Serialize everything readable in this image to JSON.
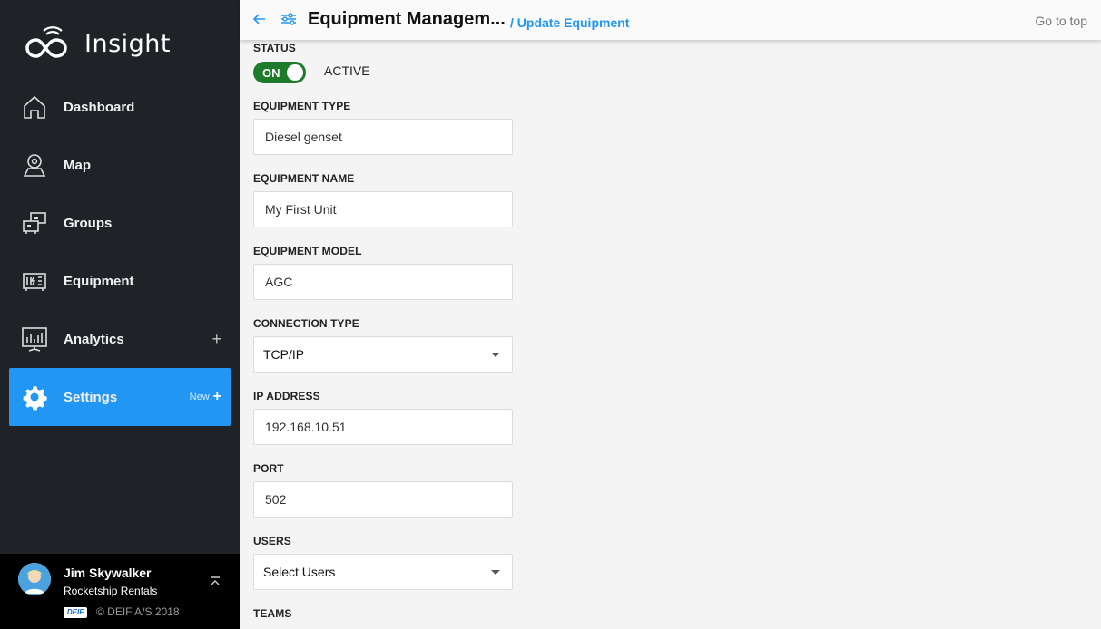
{
  "sidebar": {
    "brand": "Insight",
    "items": [
      {
        "label": "Dashboard",
        "icon": "home-icon"
      },
      {
        "label": "Map",
        "icon": "map-pin-icon"
      },
      {
        "label": "Groups",
        "icon": "groups-icon"
      },
      {
        "label": "Equipment",
        "icon": "equipment-icon"
      },
      {
        "label": "Analytics",
        "icon": "analytics-icon",
        "plus": "+"
      },
      {
        "label": "Settings",
        "icon": "gear-icon",
        "badge": "New",
        "plus": "+"
      }
    ],
    "user": {
      "name": "Jim Skywalker",
      "company": "Rocketship Rentals",
      "logo_text": "DEIF",
      "copyright": "© DEIF A/S 2018"
    }
  },
  "topbar": {
    "title": "Equipment Managem...",
    "breadcrumb": "/ Update Equipment",
    "go_top": "Go to top"
  },
  "form": {
    "status": {
      "label": "STATUS",
      "toggle": "ON",
      "state_text": "ACTIVE"
    },
    "equipment_type": {
      "label": "EQUIPMENT TYPE",
      "value": "Diesel genset"
    },
    "equipment_name": {
      "label": "EQUIPMENT NAME",
      "value": "My First Unit"
    },
    "equipment_model": {
      "label": "EQUIPMENT MODEL",
      "value": "AGC"
    },
    "connection_type": {
      "label": "CONNECTION TYPE",
      "value": "TCP/IP"
    },
    "ip_address": {
      "label": "IP ADDRESS",
      "value": "192.168.10.51"
    },
    "port": {
      "label": "PORT",
      "value": "502"
    },
    "users": {
      "label": "USERS",
      "value": "Select Users"
    },
    "teams": {
      "label": "TEAMS"
    }
  },
  "colors": {
    "sidebar_bg": "#1f2227",
    "accent": "#2196f3",
    "toggle_on": "#1e7b2b"
  }
}
